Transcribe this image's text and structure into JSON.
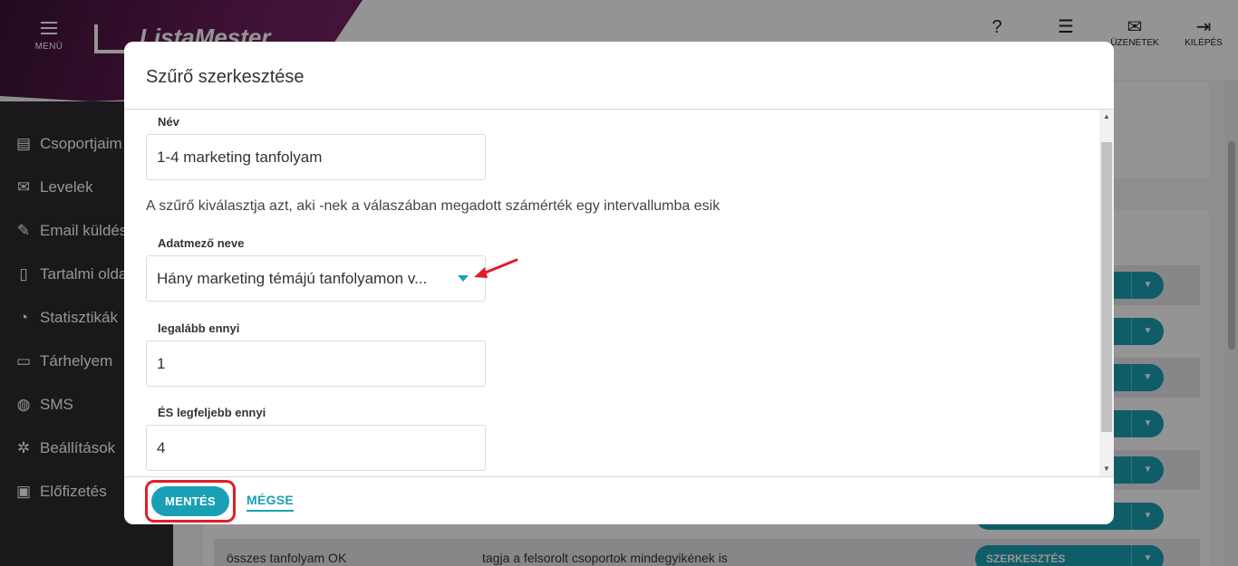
{
  "app": {
    "menu_label": "MENÜ",
    "brand": "ListaMester",
    "top_icons": [
      {
        "icon": "help-icon",
        "label": ""
      },
      {
        "icon": "list-icon",
        "label": ""
      },
      {
        "icon": "mail-icon",
        "label": "ÜZENETEK"
      },
      {
        "icon": "logout-icon",
        "label": "KILÉPÉS"
      }
    ],
    "sidebar": [
      {
        "icon": "clipboard-icon",
        "label": "Csoportjaim"
      },
      {
        "icon": "envelope-icon",
        "label": "Levelek"
      },
      {
        "icon": "pencil-icon",
        "label": "Email küldés"
      },
      {
        "icon": "book-icon",
        "label": "Tartalmi oldalak"
      },
      {
        "icon": "pie-chart-icon",
        "label": "Statisztikák"
      },
      {
        "icon": "storage-icon",
        "label": "Tárhelyem"
      },
      {
        "icon": "chat-icon",
        "label": "SMS"
      },
      {
        "icon": "gear-icon",
        "label": "Beállítások"
      },
      {
        "icon": "billing-icon",
        "label": "Előfizetés"
      }
    ],
    "bottom_row": {
      "name": "összes tanfolyam OK",
      "description": "tagja a felsorolt csoportok mindegyikének is",
      "action": "SZERKESZTÉS"
    }
  },
  "modal": {
    "title": "Szűrő szerkesztése",
    "fields": {
      "name_label": "Név",
      "name_value": "1-4 marketing tanfolyam",
      "hint": "A szűrő kiválasztja azt, aki -nek a válaszában megadott számérték egy intervallumba esik",
      "datafield_label": "Adatmező neve",
      "datafield_value": "Hány marketing témájú tanfolyamon v...",
      "min_label": "legalább ennyi",
      "min_value": "1",
      "max_label": "ÉS legfeljebb ennyi",
      "max_value": "4"
    },
    "footer": {
      "save_label": "MENTÉS",
      "cancel_label": "MÉGSE"
    }
  },
  "colors": {
    "accent": "#1aa0b4",
    "highlight": "#e11d27",
    "brand": "#6a1d5c"
  }
}
